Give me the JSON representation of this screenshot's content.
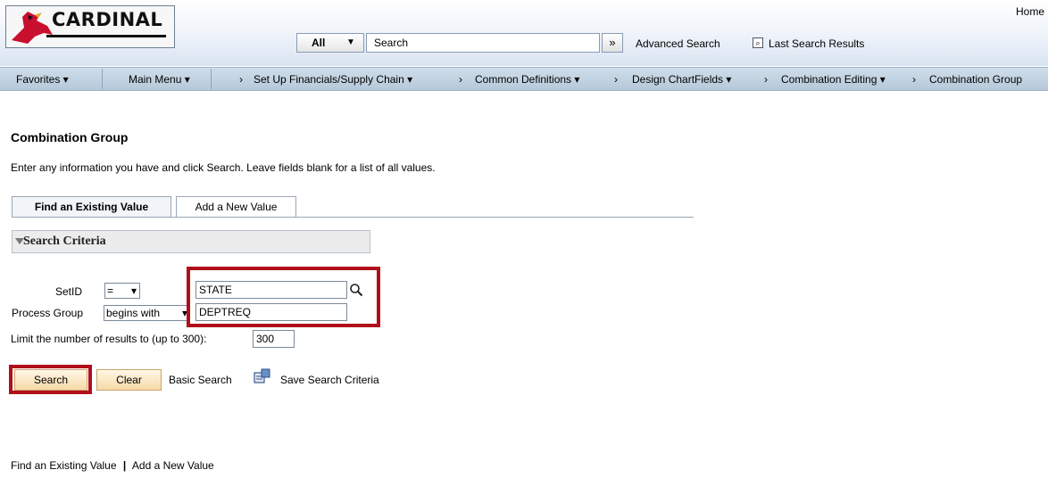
{
  "header": {
    "logo_text": "CARDINAL",
    "home_link": "Home",
    "search_scope": "All",
    "search_value": "Search",
    "advanced_search": "Advanced Search",
    "last_search_results": "Last Search Results"
  },
  "nav": {
    "favorites": "Favorites ▾",
    "main_menu": "Main Menu ▾",
    "breadcrumbs": [
      "Set Up Financials/Supply Chain ▾",
      "Common Definitions ▾",
      "Design ChartFields ▾",
      "Combination Editing ▾",
      "Combination Group"
    ]
  },
  "page": {
    "title": "Combination Group",
    "instructions": "Enter any information you have and click Search. Leave fields blank for a list of all values."
  },
  "tabs": {
    "find": "Find an Existing Value",
    "add": "Add a New Value"
  },
  "criteria": {
    "section_title": "Search Criteria",
    "setid_label": "SetID",
    "setid_operator": "=",
    "setid_value": "STATE",
    "process_group_label": "Process Group",
    "process_group_operator": "begins with",
    "process_group_value": "DEPTREQ",
    "limit_label": "Limit the number of results to (up to 300):",
    "limit_value": "300"
  },
  "actions": {
    "search": "Search",
    "clear": "Clear",
    "basic_search": "Basic Search",
    "save_search_criteria": "Save Search Criteria"
  },
  "footer": {
    "find_link": "Find an Existing Value",
    "separator": "|",
    "add_link": "Add a New Value"
  },
  "colors": {
    "highlight": "#b00f1a",
    "nav_bar": "#c4d4e3",
    "button": "#f6d9a6"
  }
}
